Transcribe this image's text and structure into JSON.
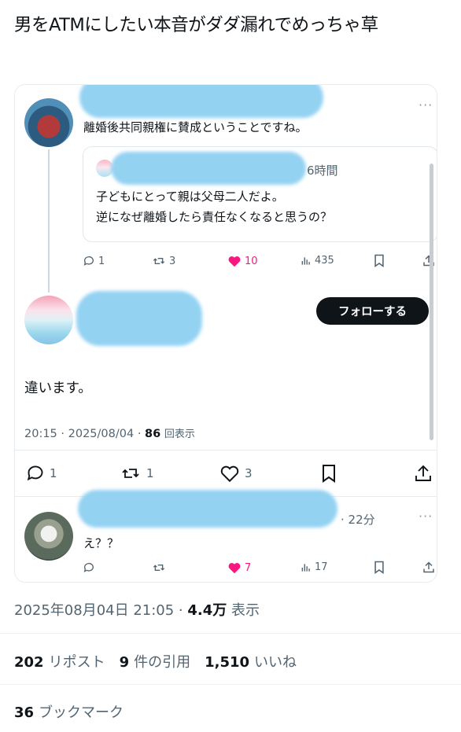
{
  "post": {
    "title": "男をATMにしたい本音がダダ漏れでめっちゃ草"
  },
  "thread": {
    "first_reply": {
      "text": "離婚後共同親権に賛成ということですね。",
      "more": "···",
      "quote": {
        "time": "6時間",
        "line1": "子どもにとって親は父母二人だよ。",
        "line2": "逆になぜ離婚したら責任なくなると思うの？"
      },
      "actions": {
        "replies": "1",
        "reposts": "3",
        "likes": "10",
        "views": "435"
      }
    },
    "focused": {
      "follow_label": "フォローする",
      "text": "違います。",
      "time": "20:15",
      "date": "2025/08/04",
      "views": "86",
      "views_suffix": "回表示",
      "actions": {
        "replies": "1",
        "reposts": "1",
        "likes": "3"
      }
    },
    "second_reply": {
      "time": "· 22分",
      "more": "···",
      "text": "え？？",
      "actions": {
        "likes": "7",
        "views": "17"
      }
    }
  },
  "footer": {
    "date_prefix": "2025年08月04日 21:05 · ",
    "views_count": "4.4万",
    "views_label": " 表示",
    "reposts_count": "202",
    "reposts_label": "リポスト",
    "quotes_count": "9",
    "quotes_label": "件の引用",
    "likes_count": "1,510",
    "likes_label": "いいね",
    "bookmarks_count": "36",
    "bookmarks_label": "ブックマーク"
  },
  "colors": {
    "like": "#f91880",
    "text": "#0f1419",
    "muted": "#536471",
    "redaction": "#8fd0f2"
  }
}
